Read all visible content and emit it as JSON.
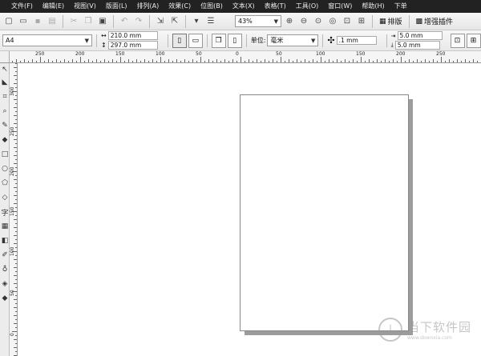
{
  "menu": [
    "文件(F)",
    "编辑(E)",
    "视图(V)",
    "版面(L)",
    "排列(A)",
    "效果(C)",
    "位图(B)",
    "文本(X)",
    "表格(T)",
    "工具(O)",
    "窗口(W)",
    "帮助(H)",
    "下单"
  ],
  "toolbar1": {
    "zoom": "43%",
    "layout_label": "排版",
    "plugin_label": "增强插件"
  },
  "toolbar2": {
    "paper_size": "A4",
    "width": "210.0 mm",
    "height": "297.0 mm",
    "unit_label": "单位:",
    "unit_value": "毫米",
    "nudge": ".1 mm",
    "dup_x": "5.0 mm",
    "dup_y": "5.0 mm"
  },
  "ruler_h_labels": [
    "250",
    "200",
    "150",
    "100",
    "50",
    "0",
    "50",
    "100",
    "150",
    "200",
    "250"
  ],
  "ruler_v_labels": [
    "300",
    "250",
    "200",
    "150",
    "100",
    "50",
    "0"
  ],
  "watermark": {
    "text": "当下软件园",
    "url": "www.downxia.com"
  },
  "colors": {
    "menubar": "#222222",
    "page_shadow": "#9c9c9c"
  }
}
